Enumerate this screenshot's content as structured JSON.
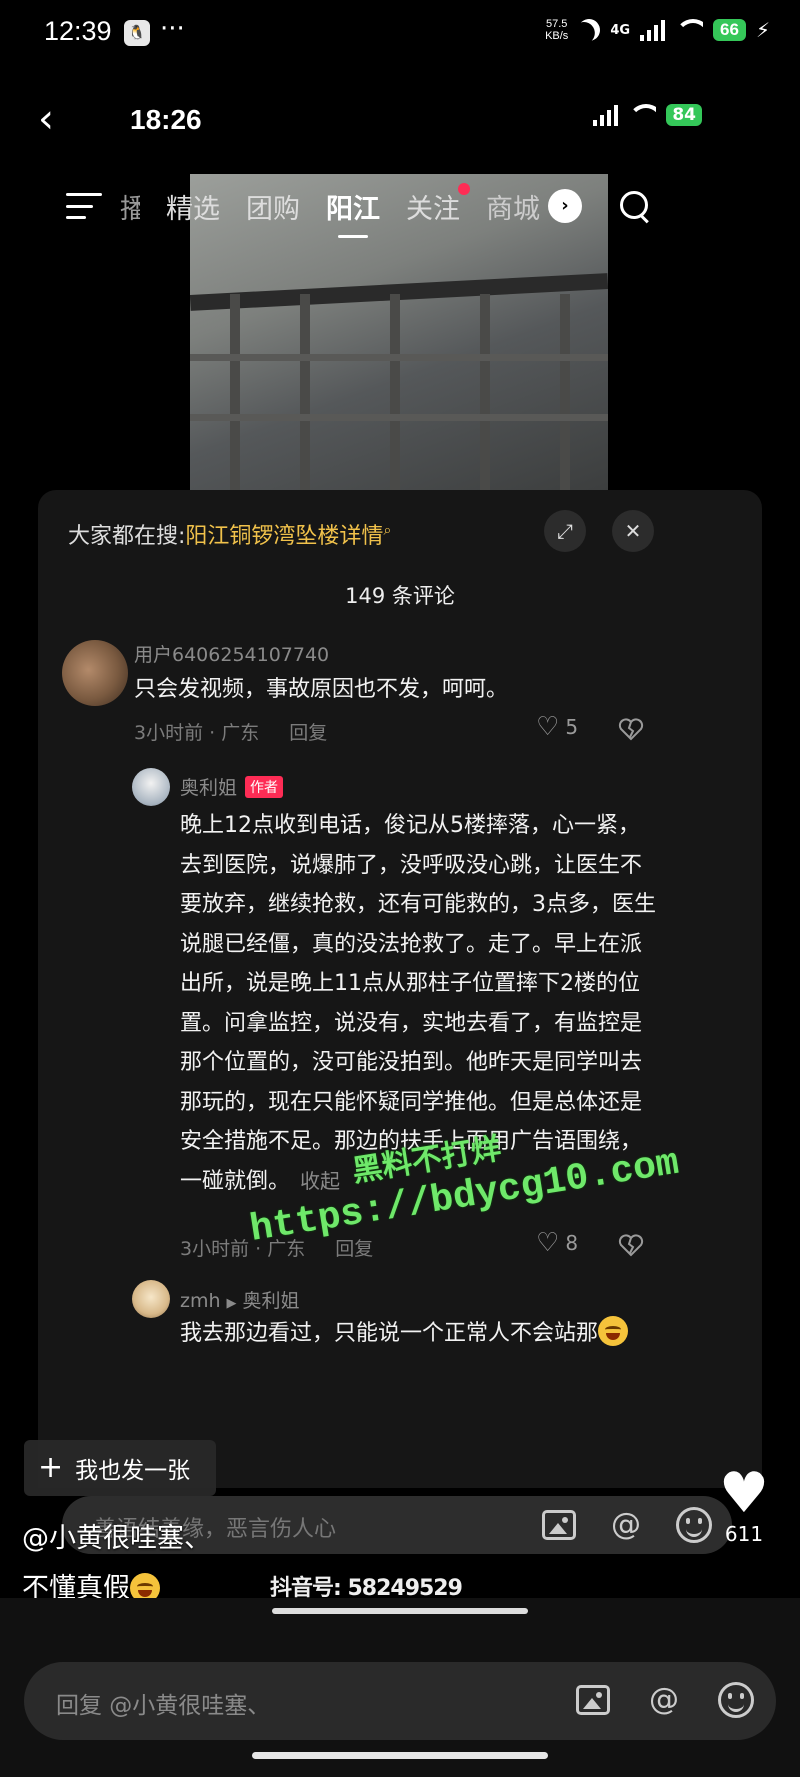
{
  "status_bar": {
    "time": "12:39",
    "dots": "···",
    "net_speed_value": "57.5",
    "net_speed_unit": "KB/s",
    "network": "4G",
    "battery": "66"
  },
  "inner_status": {
    "time": "18:26",
    "battery": "84"
  },
  "top_nav": {
    "tabs": [
      {
        "label": "播",
        "state": "partial"
      },
      {
        "label": "精选",
        "state": "normal"
      },
      {
        "label": "团购",
        "state": "normal"
      },
      {
        "label": "阳江",
        "state": "active"
      },
      {
        "label": "关注",
        "state": "dot"
      },
      {
        "label": "商城",
        "state": "clipped"
      }
    ]
  },
  "comments_panel": {
    "hot_search_prefix": "大家都在搜:",
    "hot_search_keyword": "阳江铜锣湾坠楼详情",
    "count_label": "149 条评论",
    "comments": [
      {
        "username": "用户6406254107740",
        "text": "只会发视频，事故原因也不发，呵呵。",
        "meta": "3小时前 · 广东",
        "reply_label": "回复",
        "likes": "5"
      },
      {
        "username": "奥利姐",
        "author_tag": "作者",
        "text": "晚上12点收到电话，俊记从5楼摔落，心一紧，去到医院，说爆肺了，没呼吸没心跳，让医生不要放弃，继续抢救，还有可能救的，3点多，医生说腿已经僵，真的没法抢救了。走了。早上在派出所，说是晚上11点从那柱子位置摔下2楼的位置。问拿监控，说没有，实地去看了，有监控是那个位置的，没可能没拍到。他昨天是同学叫去那玩的，现在只能怀疑同学推他。但是总体还是安全措施不足。那边的扶手上面用广告语围绕，一碰就倒。",
        "collapse_label": "收起",
        "meta": "3小时前 · 广东",
        "reply_label": "回复",
        "likes": "8"
      },
      {
        "username": "zmh",
        "reply_to": "奥利姐",
        "text": "我去那边看过，只能说一个正常人不会站那"
      }
    ],
    "post_button": "我也发一张",
    "input_placeholder": "善语结善缘，恶言伤人心"
  },
  "video_overlay": {
    "caption_line1": "@小黄很哇塞、",
    "caption_line2": "不懂真假",
    "like_count": "611",
    "douyin_id": "抖音号: 58249529"
  },
  "watermark": {
    "line1": "黑料不打烊",
    "line2": "https://bdycg10.com"
  },
  "reply_bar": {
    "placeholder": "回复 @小黄很哇塞、"
  },
  "icons": {
    "back": "back-arrow-icon",
    "menu": "menu-icon",
    "search": "search-icon",
    "expand": "expand-icon",
    "close": "close-icon",
    "image": "image-icon",
    "mention": "at-icon",
    "emoji": "emoji-icon",
    "like": "heart-icon",
    "dislike": "broken-heart-icon"
  },
  "colors": {
    "keyword": "#f1c24b",
    "author_tag": "#fe2c55",
    "watermark": "#6fe86a",
    "battery": "#35c759"
  }
}
